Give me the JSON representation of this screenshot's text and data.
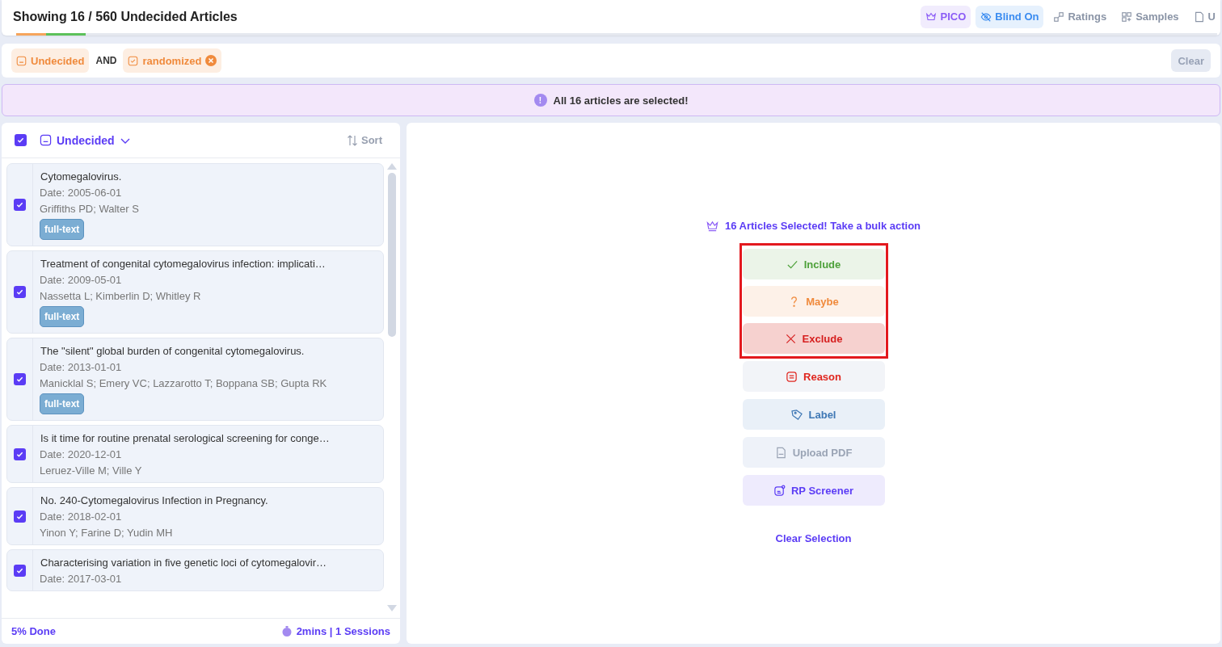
{
  "header": {
    "title": "Showing 16 / 560 Undecided Articles",
    "tools": [
      {
        "label": "PICO",
        "kind": "crown",
        "active": true
      },
      {
        "label": "Blind On",
        "kind": "eye",
        "active": true
      },
      {
        "label": "Ratings",
        "kind": "ratings",
        "active": false
      },
      {
        "label": "Samples",
        "kind": "samples",
        "active": false
      },
      {
        "label": "U",
        "kind": "pdf",
        "active": false
      }
    ],
    "progress": [
      {
        "color": "#f6a55c",
        "level": 0.025
      },
      {
        "color": "#5cc15a",
        "level": 0.033
      }
    ]
  },
  "filters": {
    "chips": [
      {
        "label": "Undecided",
        "kind": "face",
        "removable": false
      },
      {
        "label": "randomized",
        "kind": "check",
        "removable": true
      }
    ],
    "joiner": "AND",
    "clear": "Clear"
  },
  "banner": {
    "icon": "!",
    "text": "All 16 articles are selected!"
  },
  "list": {
    "all_checked": true,
    "group": "Undecided",
    "sort": "Sort",
    "items": [
      {
        "title": "Cytomegalovirus.",
        "date": "Date: 2005-06-01",
        "authors": "Griffiths PD; Walter S",
        "tag": "full-text",
        "checked": true
      },
      {
        "title": "Treatment of congenital cytomegalovirus infection: implicati…",
        "date": "Date: 2009-05-01",
        "authors": "Nassetta L; Kimberlin D; Whitley R",
        "tag": "full-text",
        "checked": true
      },
      {
        "title": "The \"silent\" global burden of congenital cytomegalovirus.",
        "date": "Date: 2013-01-01",
        "authors": "Manicklal S; Emery VC; Lazzarotto T; Boppana SB; Gupta RK",
        "tag": "full-text",
        "checked": true
      },
      {
        "title": "Is it time for routine prenatal serological screening for conge…",
        "date": "Date: 2020-12-01",
        "authors": "Leruez-Ville M; Ville Y",
        "checked": true
      },
      {
        "title": "No. 240-Cytomegalovirus Infection in Pregnancy.",
        "date": "Date: 2018-02-01",
        "authors": "Yinon Y; Farine D; Yudin MH",
        "checked": true
      },
      {
        "title": "Characterising variation in five genetic loci of cytomegalovir…",
        "date": "Date: 2017-03-01",
        "checked": true
      }
    ],
    "footer": {
      "done": "5% Done",
      "time": "2mins | 1 Sessions"
    }
  },
  "bulk": {
    "heading": "16 Articles Selected! Take a bulk action",
    "highlighted": true,
    "decisions": [
      {
        "label": "Include",
        "kind": "include"
      },
      {
        "label": "Maybe",
        "kind": "maybe"
      },
      {
        "label": "Exclude",
        "kind": "exclude"
      }
    ],
    "actions": [
      {
        "label": "Reason",
        "kind": "reason",
        "disabled": false
      },
      {
        "label": "Label",
        "kind": "label",
        "disabled": false
      },
      {
        "label": "Upload PDF",
        "kind": "pdf",
        "disabled": true
      },
      {
        "label": "RP Screener",
        "kind": "screener",
        "disabled": false
      }
    ],
    "clear": "Clear Selection"
  }
}
